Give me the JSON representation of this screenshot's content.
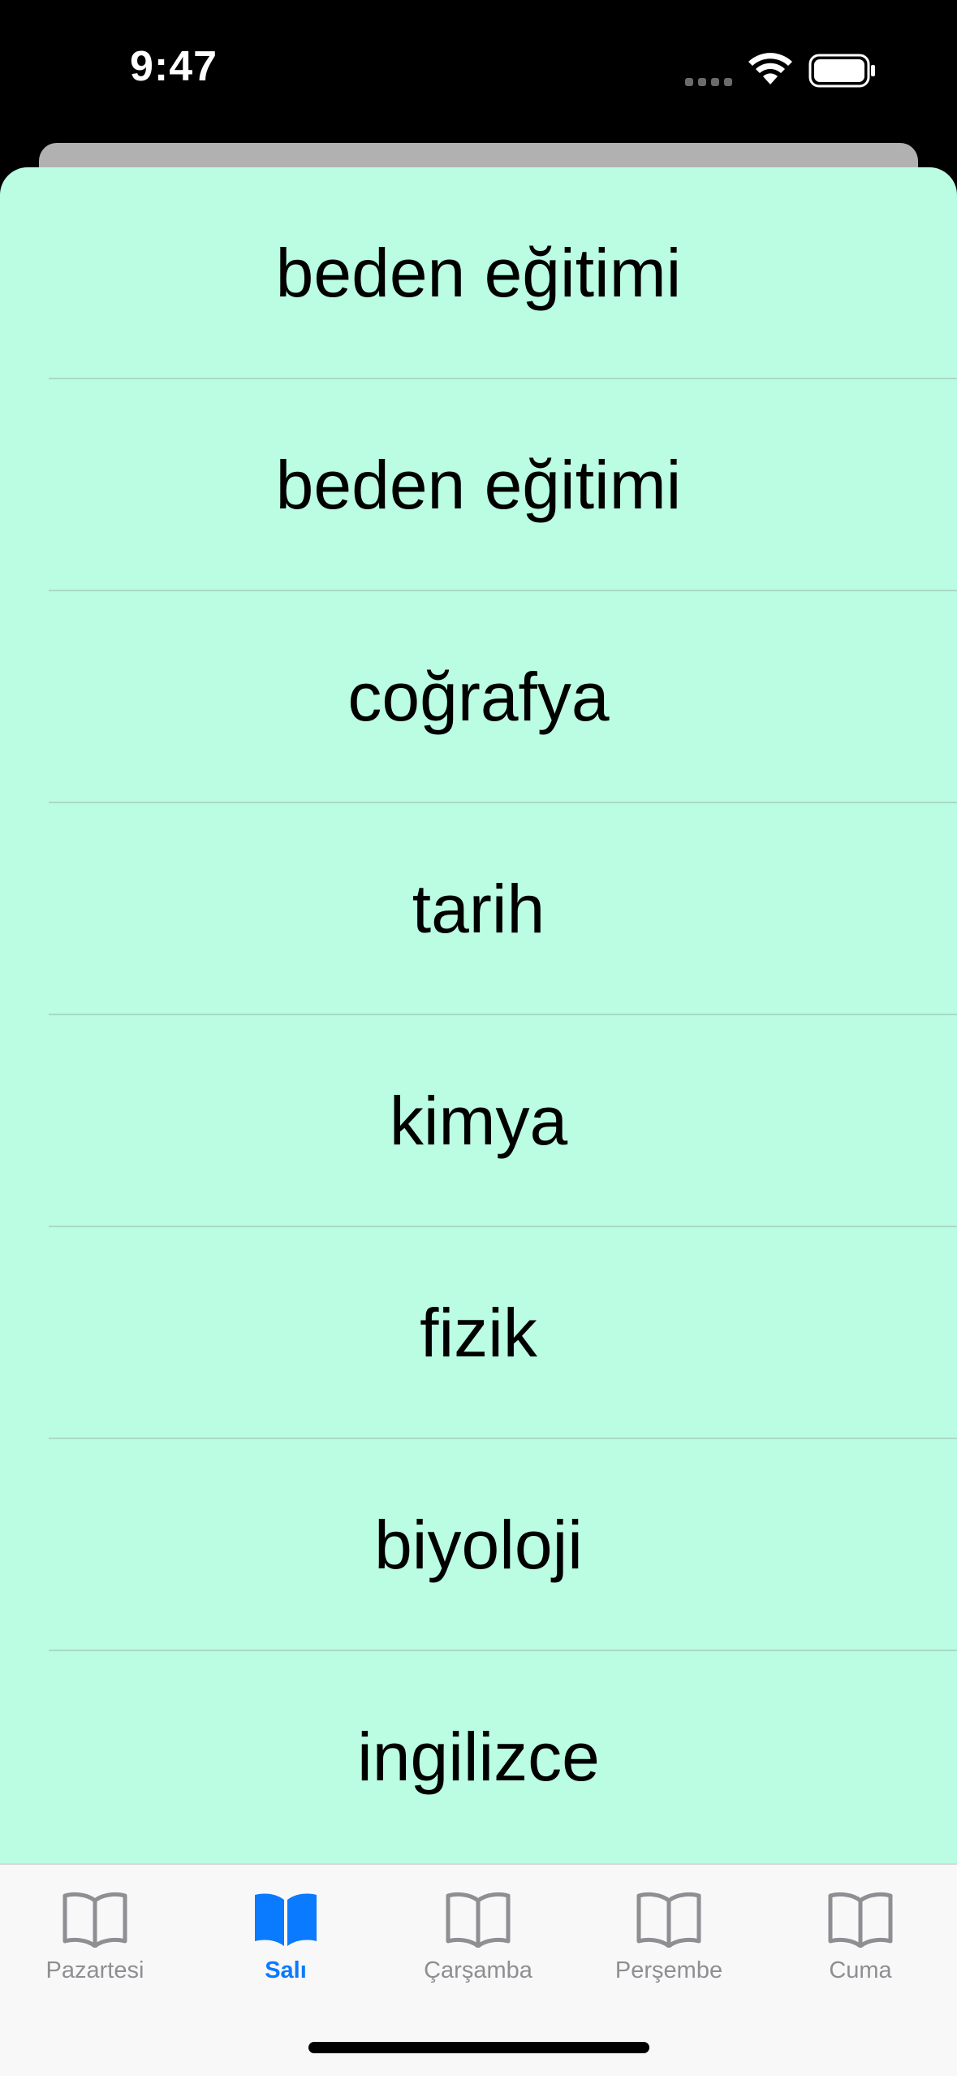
{
  "status_bar": {
    "time": "9:47"
  },
  "list": {
    "items": [
      {
        "label": "beden eğitimi"
      },
      {
        "label": "beden eğitimi"
      },
      {
        "label": "coğrafya"
      },
      {
        "label": "tarih"
      },
      {
        "label": "kimya"
      },
      {
        "label": "fizik"
      },
      {
        "label": "biyoloji"
      },
      {
        "label": "ingilizce"
      }
    ]
  },
  "tabbar": {
    "tabs": [
      {
        "label": "Pazartesi",
        "icon": "book-icon",
        "active": false
      },
      {
        "label": "Salı",
        "icon": "book-filled-icon",
        "active": true
      },
      {
        "label": "Çarşamba",
        "icon": "book-icon",
        "active": false
      },
      {
        "label": "Perşembe",
        "icon": "book-icon",
        "active": false
      },
      {
        "label": "Cuma",
        "icon": "book-icon",
        "active": false
      }
    ]
  },
  "colors": {
    "sheet_background": "#bafde3",
    "accent": "#0a7aff",
    "inactive": "#8e8e93"
  }
}
